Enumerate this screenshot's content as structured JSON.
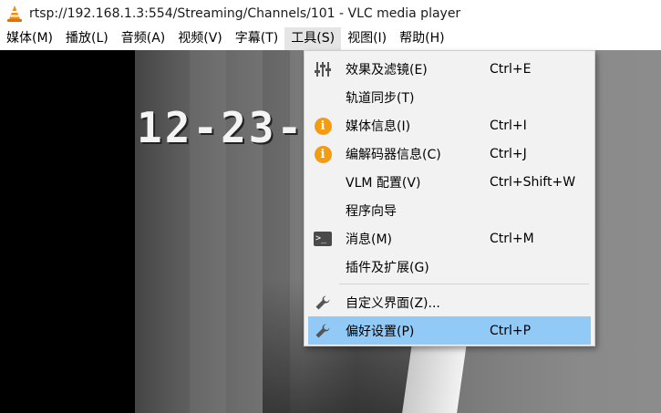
{
  "window": {
    "title": "rtsp://192.168.1.3:554/Streaming/Channels/101 - VLC media player",
    "app_icon": "vlc-cone-icon"
  },
  "menubar": {
    "items": [
      {
        "label": "媒体(M)"
      },
      {
        "label": "播放(L)"
      },
      {
        "label": "音频(A)"
      },
      {
        "label": "视频(V)"
      },
      {
        "label": "字幕(T)"
      },
      {
        "label": "工具(S)",
        "open": true
      },
      {
        "label": "视图(I)"
      },
      {
        "label": "帮助(H)"
      }
    ]
  },
  "video": {
    "osd_text": "12-23-2"
  },
  "tools_menu": {
    "items": [
      {
        "label": "效果及滤镜(E)",
        "shortcut": "Ctrl+E",
        "icon": "equalizer-icon"
      },
      {
        "label": "轨道同步(T)",
        "shortcut": "",
        "icon": ""
      },
      {
        "label": "媒体信息(I)",
        "shortcut": "Ctrl+I",
        "icon": "info-icon"
      },
      {
        "label": "编解码器信息(C)",
        "shortcut": "Ctrl+J",
        "icon": "info-icon"
      },
      {
        "label": "VLM 配置(V)",
        "shortcut": "Ctrl+Shift+W",
        "icon": ""
      },
      {
        "label": "程序向导",
        "shortcut": "",
        "icon": ""
      },
      {
        "label": "消息(M)",
        "shortcut": "Ctrl+M",
        "icon": "terminal-icon"
      },
      {
        "label": "插件及扩展(G)",
        "shortcut": "",
        "icon": ""
      },
      {
        "label": "自定义界面(Z)...",
        "shortcut": "",
        "icon": "wrench-icon"
      },
      {
        "label": "偏好设置(P)",
        "shortcut": "Ctrl+P",
        "icon": "wrench-icon",
        "highlighted": true
      }
    ]
  },
  "colors": {
    "menu_highlight": "#91c9f7",
    "info_icon": "#f39c12",
    "vlc_orange": "#ff8800"
  }
}
